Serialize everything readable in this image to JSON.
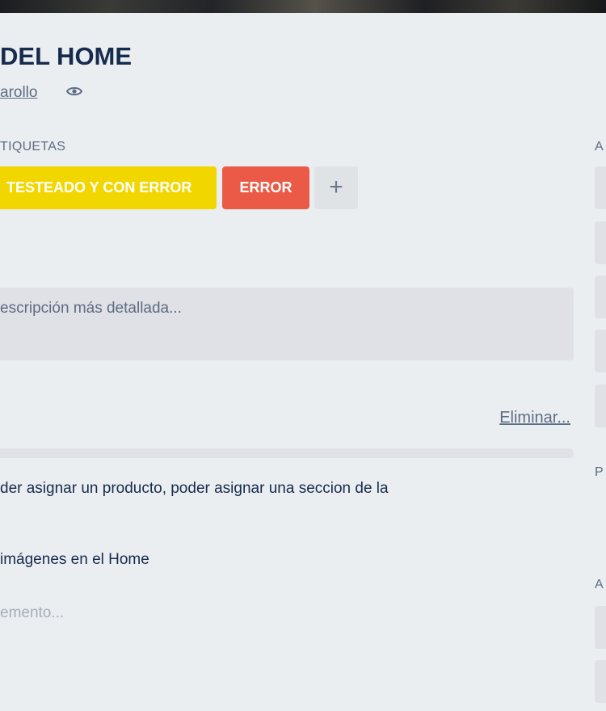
{
  "card": {
    "title": "DEL HOME",
    "list_name": "arollo"
  },
  "labels": {
    "heading": "TIQUETAS",
    "items": [
      {
        "text": "TESTEADO Y CON ERROR",
        "color": "#f2d600"
      },
      {
        "text": "ERROR",
        "color": "#eb5a46"
      }
    ],
    "add_label": "+"
  },
  "description": {
    "placeholder": "escripción más detallada..."
  },
  "checklist": {
    "delete_label": "Eliminar..."
  },
  "content": {
    "line1": "der asignar un producto, poder asignar una seccion de la",
    "line2": "imágenes en el Home"
  },
  "comment": {
    "placeholder": "emento..."
  },
  "sidebar": {
    "heading_1": "A",
    "heading_2": "P",
    "heading_3": "A"
  },
  "icons": {
    "watch": "eye-icon"
  }
}
